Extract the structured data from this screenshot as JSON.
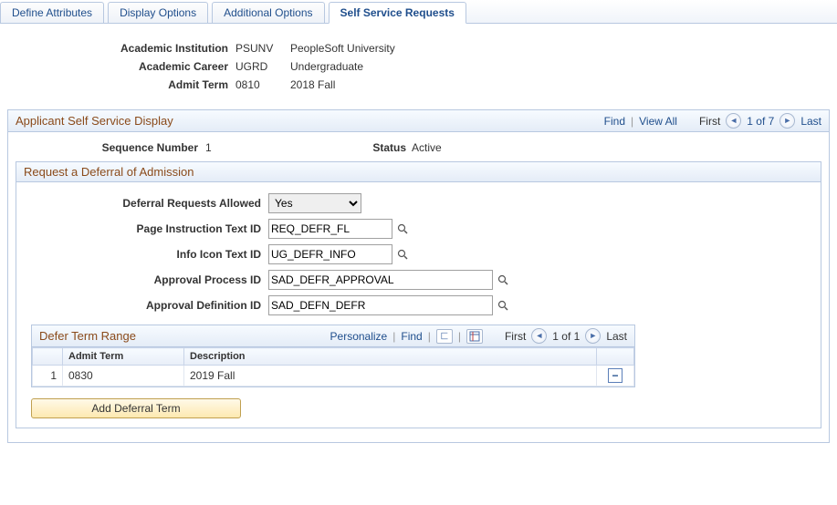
{
  "tabs": {
    "items": [
      {
        "label": "Define Attributes"
      },
      {
        "label": "Display Options"
      },
      {
        "label": "Additional Options"
      },
      {
        "label": "Self Service Requests"
      }
    ],
    "active_index": 3
  },
  "header": {
    "institution_label": "Academic Institution",
    "institution_code": "PSUNV",
    "institution_name": "PeopleSoft University",
    "career_label": "Academic Career",
    "career_code": "UGRD",
    "career_name": "Undergraduate",
    "term_label": "Admit Term",
    "term_code": "0810",
    "term_name": "2018 Fall"
  },
  "section": {
    "title": "Applicant Self Service Display",
    "find": "Find",
    "view_all": "View All",
    "first": "First",
    "counter": "1 of 7",
    "last": "Last",
    "seq_label": "Sequence Number",
    "seq_value": "1",
    "status_label": "Status",
    "status_value": "Active"
  },
  "deferral": {
    "title": "Request a Deferral of Admission",
    "allowed_label": "Deferral Requests Allowed",
    "allowed_value": "Yes",
    "page_instr_label": "Page Instruction Text ID",
    "page_instr_value": "REQ_DEFR_FL",
    "info_icon_label": "Info Icon Text ID",
    "info_icon_value": "UG_DEFR_INFO",
    "approval_proc_label": "Approval Process ID",
    "approval_proc_value": "SAD_DEFR_APPROVAL",
    "approval_def_label": "Approval Definition ID",
    "approval_def_value": "SAD_DEFN_DEFR"
  },
  "grid": {
    "title": "Defer Term Range",
    "personalize": "Personalize",
    "find": "Find",
    "first": "First",
    "counter": "1 of 1",
    "last": "Last",
    "col_admit": "Admit Term",
    "col_desc": "Description",
    "rows": [
      {
        "n": "1",
        "term": "0830",
        "desc": "2019 Fall"
      }
    ],
    "add_btn": "Add Deferral Term"
  }
}
